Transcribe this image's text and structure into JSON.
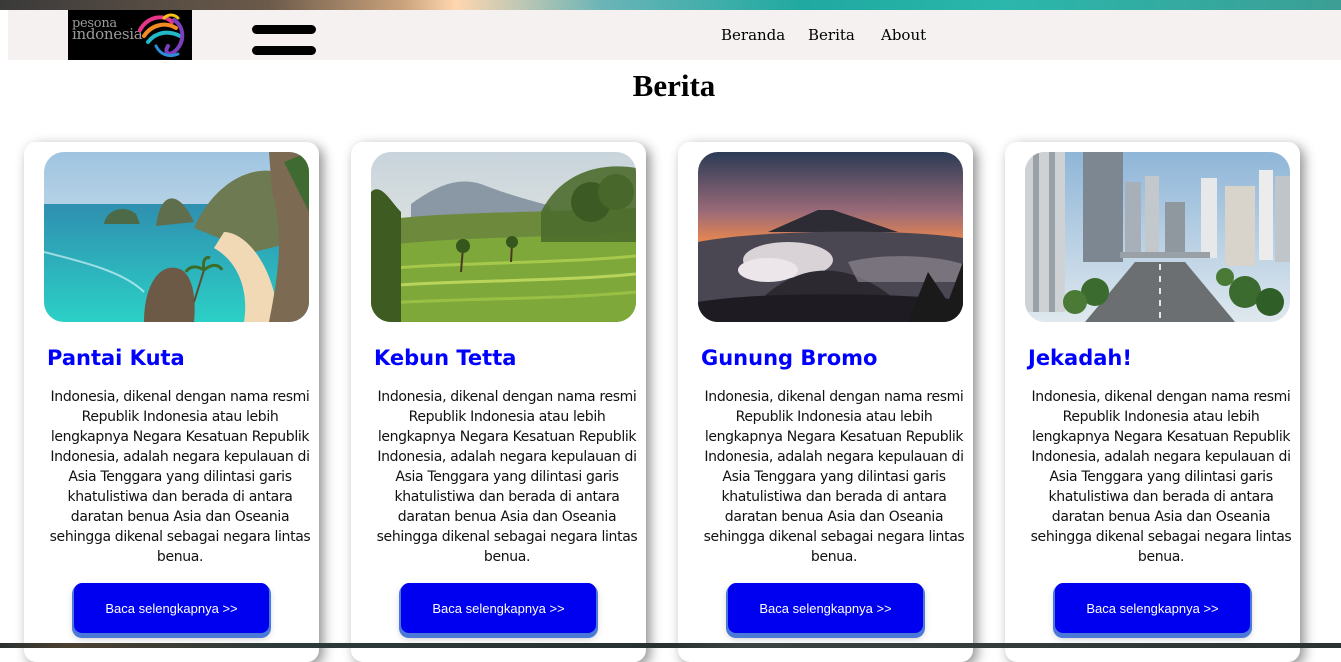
{
  "logo": {
    "line1": "pesona",
    "line2": "indonesia"
  },
  "nav": {
    "links": [
      "Beranda",
      "Berita",
      "About"
    ]
  },
  "page": {
    "title": "Berita"
  },
  "cards": [
    {
      "title": "Pantai Kuta",
      "image": "beach-cliffs",
      "text": "Indonesia, dikenal dengan nama resmi Republik Indonesia atau lebih lengkapnya Negara Kesatuan Republik Indonesia, adalah negara kepulauan di Asia Tenggara yang dilintasi garis khatulistiwa dan berada di antara daratan benua Asia dan Oseania sehingga dikenal sebagai negara lintas benua.",
      "button": "Baca selengkapnya >>"
    },
    {
      "title": "Kebun Tetta",
      "image": "rice-terraces",
      "text": "Indonesia, dikenal dengan nama resmi Republik Indonesia atau lebih lengkapnya Negara Kesatuan Republik Indonesia, adalah negara kepulauan di Asia Tenggara yang dilintasi garis khatulistiwa dan berada di antara daratan benua Asia dan Oseania sehingga dikenal sebagai negara lintas benua.",
      "button": "Baca selengkapnya >>"
    },
    {
      "title": "Gunung Bromo",
      "image": "volcano-sunrise",
      "text": "Indonesia, dikenal dengan nama resmi Republik Indonesia atau lebih lengkapnya Negara Kesatuan Republik Indonesia, adalah negara kepulauan di Asia Tenggara yang dilintasi garis khatulistiwa dan berada di antara daratan benua Asia dan Oseania sehingga dikenal sebagai negara lintas benua.",
      "button": "Baca selengkapnya >>"
    },
    {
      "title": "Jekadah!",
      "image": "city-skyline",
      "text": "Indonesia, dikenal dengan nama resmi Republik Indonesia atau lebih lengkapnya Negara Kesatuan Republik Indonesia, adalah negara kepulauan di Asia Tenggara yang dilintasi garis khatulistiwa dan berada di antara daratan benua Asia dan Oseania sehingga dikenal sebagai negara lintas benua.",
      "button": "Baca selengkapnya >>"
    }
  ],
  "colors": {
    "title": "#0000ff",
    "button": "#0000f0",
    "navbar": "#f6f1f1"
  }
}
